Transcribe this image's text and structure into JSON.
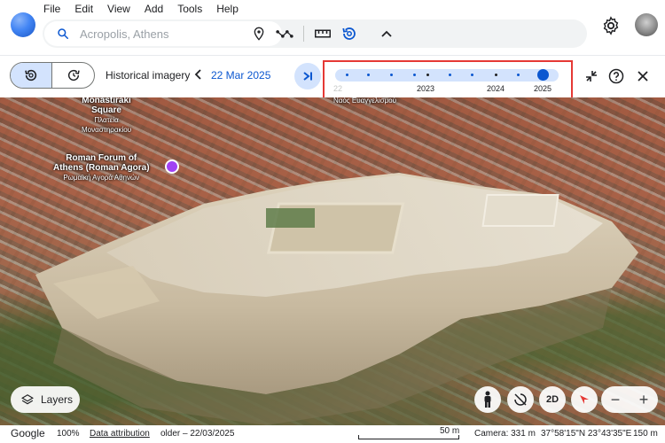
{
  "menu": [
    "File",
    "Edit",
    "View",
    "Add",
    "Tools",
    "Help"
  ],
  "search": {
    "placeholder": "Acropolis, Athens"
  },
  "toolbar_icons": [
    "pin-icon",
    "path-icon",
    "ruler-icon",
    "history-icon",
    "chevron-up-icon"
  ],
  "history": {
    "label": "Historical imagery",
    "date": "22 Mar 2025",
    "timeline": {
      "years": [
        {
          "label": "2023",
          "faded": false
        },
        {
          "label": "2024",
          "faded": false
        },
        {
          "label": "2025",
          "faded": false
        }
      ],
      "edge_label": "22",
      "selected_year": "2025"
    }
  },
  "map_labels": {
    "monastiraki_1": "Monastiraki",
    "monastiraki_2": "Square",
    "monastiraki_gr": "Πλατεία",
    "monastiraki_gr2": "Μοναστηρακίου",
    "roman_1": "Roman Forum of",
    "roman_2": "Athens (Roman Agora)",
    "roman_gr": "Ρωμαϊκή Αγορά Αθηνών",
    "top_street": "Ναός Ευαγγελισμού"
  },
  "controls": {
    "layers": "Layers",
    "mode_2d": "2D",
    "zoom_out": "−",
    "zoom_in": "+"
  },
  "status": {
    "brand": "Google",
    "zoom": "100%",
    "attribution": "Data attribution",
    "imagery": "older – 22/03/2025",
    "scale": "50 m",
    "camera": "Camera: 331 m",
    "coords": "37°58'15\"N 23°43'35\"E",
    "elevation": "150 m"
  },
  "colors": {
    "accent": "#0b57d0",
    "accent_light": "#d3e3fd",
    "highlight": "#e53935"
  }
}
